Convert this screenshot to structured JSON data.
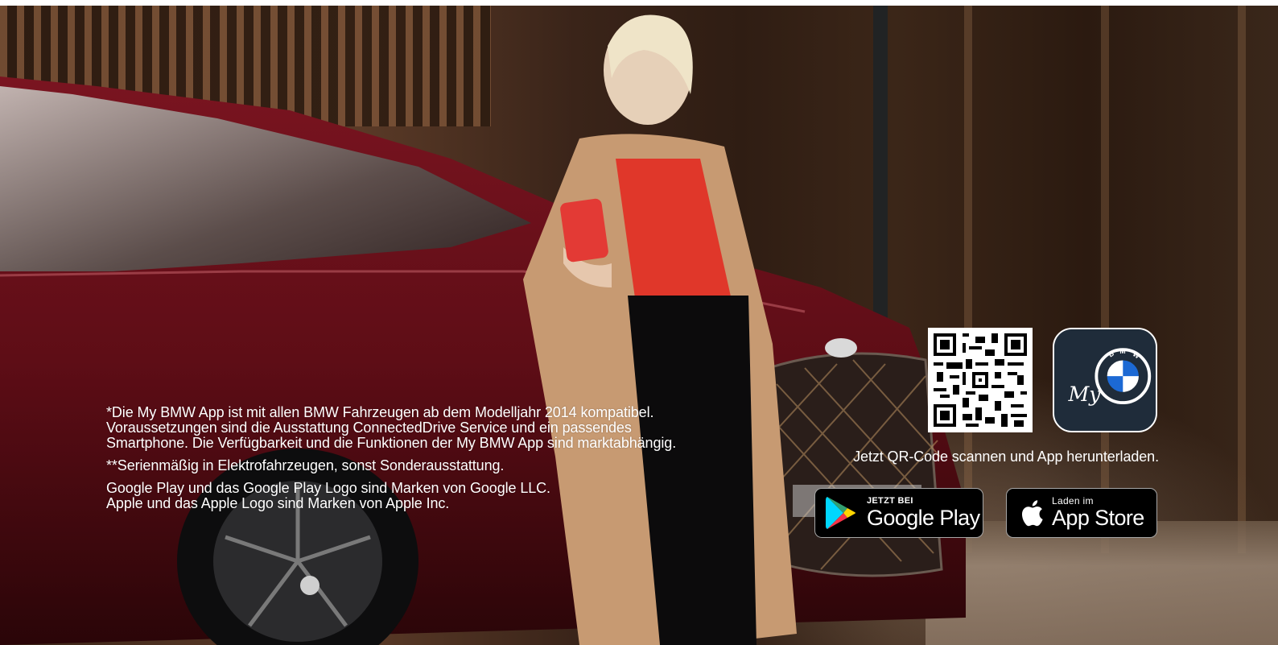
{
  "legal": {
    "line1": "*Die My BMW App ist mit allen BMW Fahrzeugen ab dem Modelljahr 2014 kompatibel.",
    "line2": "Voraussetzungen sind die Ausstattung ConnectedDrive Service und ein passendes",
    "line3": "Smartphone. Die Verfügbarkeit und die Funktionen der My BMW App sind marktabhängig.",
    "footnote2": "**Serienmäßig in Elektrofahrzeugen, sonst Sonderausstattung.",
    "trademark1": "Google Play und das Google Play Logo sind Marken von Google LLC.",
    "trademark2": "Apple und das Apple Logo sind Marken von Apple Inc."
  },
  "qr_caption": "Jetzt QR-Code scannen und App herunterladen.",
  "google_play": {
    "small": "JETZT BEI",
    "big": "Google Play"
  },
  "app_store": {
    "small": "Laden im",
    "big": "App Store"
  },
  "app_icon": {
    "logo_letters": [
      "B",
      "M",
      "W"
    ],
    "script": "My"
  },
  "colors": {
    "app_icon_bg": "#1f2c3a",
    "bmw_blue": "#1c69d4",
    "text": "#ffffff",
    "badge_bg": "#000000"
  },
  "icons": [
    "qr-code-icon",
    "my-bmw-app-icon",
    "google-play-icon",
    "apple-icon"
  ]
}
